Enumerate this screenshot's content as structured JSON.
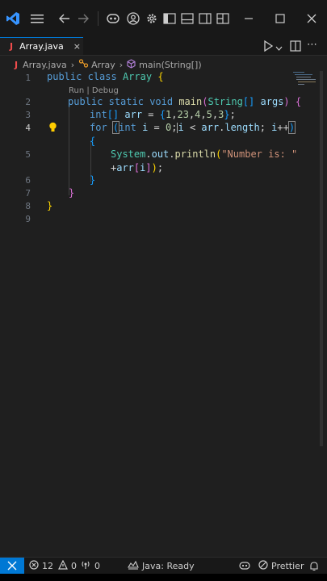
{
  "tab": {
    "icon_letter": "J",
    "name": "Array.java",
    "close": "×"
  },
  "breadcrumb": {
    "file_icon_letter": "J",
    "file": "Array.java",
    "sep": "›",
    "class": "Array",
    "method": "main(String[])"
  },
  "editor": {
    "line_numbers": [
      "1",
      "2",
      "3",
      "4",
      "5",
      "6",
      "7",
      "8",
      "9"
    ],
    "active_line": "4",
    "codelens": "Run | Debug",
    "tokens": {
      "public": "public",
      "class": "class",
      "array": "Array",
      "static": "static",
      "void": "void",
      "main": "main",
      "string": "String",
      "args": "args",
      "int": "int",
      "arr": "arr",
      "n1": "1",
      "n23": "23",
      "n4": "4",
      "n5": "5",
      "n3": "3",
      "for": "for",
      "i": "i",
      "zero": "0",
      "length": "length",
      "system": "System",
      "out": "out",
      "println": "println",
      "str": "\"Number is: \""
    }
  },
  "statusbar": {
    "errors": "12",
    "warnings": "0",
    "ports": "0",
    "java_status": "Java: Ready",
    "prettier": "Prettier"
  },
  "colors": {
    "accent": "#0078d4",
    "error_icon": "#f14c4c"
  }
}
